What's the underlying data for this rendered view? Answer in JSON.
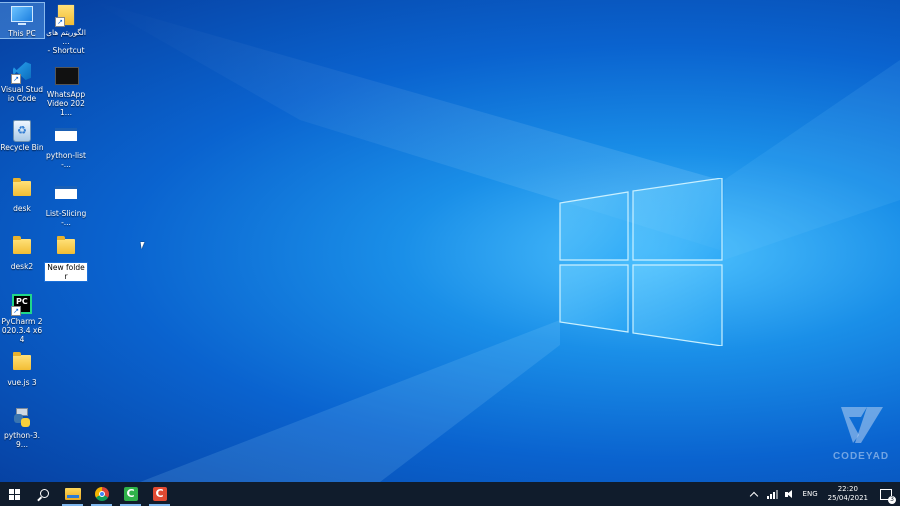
{
  "desktop": {
    "icons": [
      {
        "label": "This PC",
        "icon": "computer-icon"
      },
      {
        "label": "الگوریتم های ...\n- Shortcut",
        "icon": "folder-shortcut-icon"
      },
      {
        "label": "Visual Studio Code",
        "icon": "vscode-icon"
      },
      {
        "label": "WhatsApp Video 2021...",
        "icon": "video-file-icon"
      },
      {
        "label": "Recycle Bin",
        "icon": "recycle-bin-icon"
      },
      {
        "label": "python-list-...",
        "icon": "image-file-icon"
      },
      {
        "label": "desk",
        "icon": "zip-folder-icon"
      },
      {
        "label": "List-Slicing-...",
        "icon": "image-file-icon"
      },
      {
        "label": "desk2",
        "icon": "zip-folder-icon"
      },
      {
        "label": "New folder",
        "icon": "folder-icon"
      },
      {
        "label": "PyCharm 2020.3.4 x64",
        "icon": "pycharm-icon"
      },
      {
        "label": "vue.js 3",
        "icon": "zip-folder-icon"
      },
      {
        "label": "python-3.9...",
        "icon": "python-installer-icon"
      }
    ]
  },
  "watermark": {
    "text": "CODEYAD"
  },
  "taskbar": {
    "apps": [
      "windows-start-icon",
      "search-icon",
      "file-explorer-icon",
      "chrome-icon",
      "camtasia-icon",
      "camtasia-recorder-icon"
    ],
    "tray": {
      "language": "ENG",
      "time": "22:20",
      "date": "25/04/2021",
      "notification_count": "3"
    }
  }
}
